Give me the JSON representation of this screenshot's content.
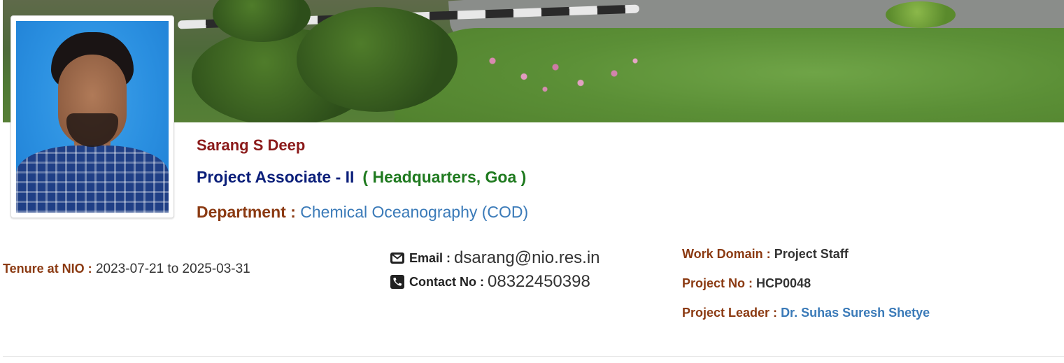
{
  "profile": {
    "name": "Sarang S Deep",
    "designation": "Project Associate - II",
    "location": "( Headquarters, Goa )",
    "department_label": "Department :",
    "department_value": "Chemical Oceanography (COD)"
  },
  "tenure": {
    "label": "Tenure at NIO :",
    "value": "2023-07-21 to 2025-03-31"
  },
  "contact": {
    "email_icon": "envelope-icon",
    "email_label": "Email :",
    "email_value": "dsarang@nio.res.in",
    "phone_icon": "phone-icon",
    "phone_label": "Contact No :",
    "phone_value": "08322450398"
  },
  "work": {
    "domain_label": "Work Domain :",
    "domain_value": "Project Staff",
    "project_no_label": "Project No :",
    "project_no_value": "HCP0048",
    "leader_label": "Project Leader :",
    "leader_value": "Dr. Suhas Suresh Shetye"
  },
  "colors": {
    "name": "#8b1a1a",
    "designation": "#0b1f7a",
    "location": "#1f7a1f",
    "label": "#8b3a12",
    "link": "#3a7ab8"
  }
}
